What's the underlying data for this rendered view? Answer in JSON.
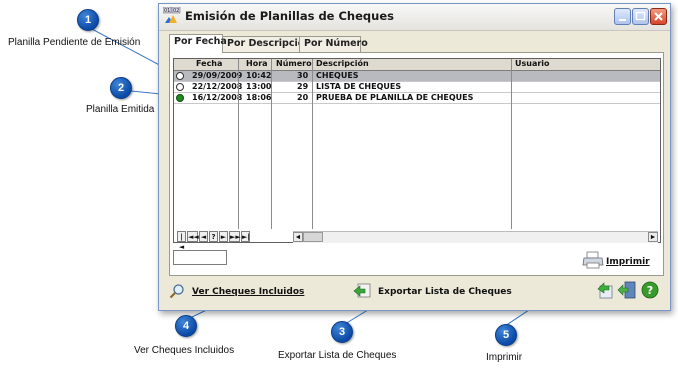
{
  "window": {
    "title": "Emisión de Planillas de Cheques",
    "icon_badges": [
      "01",
      "02"
    ]
  },
  "tabs": [
    {
      "label": "Por Fecha",
      "active": true
    },
    {
      "label": "Por Descripción",
      "active": false
    },
    {
      "label": "Por Número",
      "active": false
    }
  ],
  "grid": {
    "columns": [
      "Fecha",
      "Hora",
      "Número",
      "Descripción",
      "Usuario"
    ],
    "rows": [
      {
        "status": "pending",
        "fecha": "29/09/2009",
        "hora": "10:42",
        "numero": "30",
        "descripcion": "CHEQUES",
        "usuario": "",
        "selected": true
      },
      {
        "status": "pending",
        "fecha": "22/12/2008",
        "hora": "13:00",
        "numero": "29",
        "descripcion": "LISTA DE CHEQUES",
        "usuario": "",
        "selected": false
      },
      {
        "status": "issued",
        "fecha": "16/12/2008",
        "hora": "18:06",
        "numero": "20",
        "descripcion": "PRUEBA DE PLANILLA DE CHEQUES",
        "usuario": "",
        "selected": false
      }
    ],
    "nav_buttons": [
      "|◄",
      "◄◄",
      "◄",
      "?",
      "►",
      "►►",
      "►|"
    ]
  },
  "actions": {
    "imprimir": "Imprimir",
    "ver_cheques": "Ver Cheques Incluidos",
    "exportar": "Exportar Lista de Cheques"
  },
  "callouts": [
    {
      "number": "1",
      "label": "Planilla Pendiente de Emisión"
    },
    {
      "number": "2",
      "label": "Planilla Emitida"
    },
    {
      "number": "3",
      "label": "Exportar Lista de Cheques"
    },
    {
      "number": "4",
      "label": "Ver Cheques Incluidos"
    },
    {
      "number": "5",
      "label": "Imprimir"
    }
  ],
  "colors": {
    "callout": "#1565c0",
    "selected_row": "#b9bac0",
    "issued_dot": "#1e8c1e"
  }
}
